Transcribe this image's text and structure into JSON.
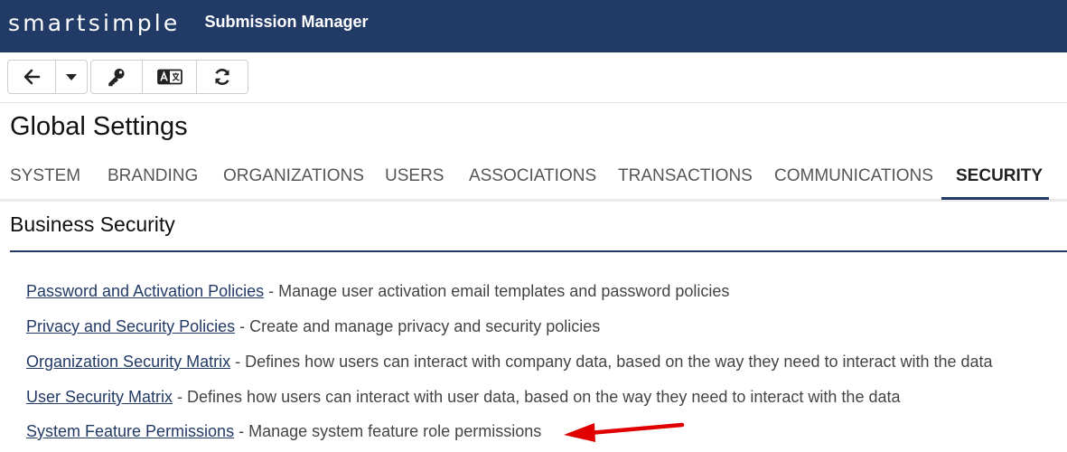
{
  "header": {
    "logo_text": "smartsimple",
    "app_title": "Submission Manager"
  },
  "toolbar": {
    "buttons": [
      {
        "icon": "arrow-left-icon",
        "label": "Back"
      },
      {
        "icon": "caret-down-icon",
        "label": "History"
      },
      {
        "icon": "key-icon",
        "label": "Key"
      },
      {
        "icon": "translate-icon",
        "label": "Translate"
      },
      {
        "icon": "refresh-icon",
        "label": "Refresh"
      }
    ]
  },
  "page": {
    "title": "Global Settings"
  },
  "tabs": [
    {
      "label": "SYSTEM",
      "active": false
    },
    {
      "label": "BRANDING",
      "active": false
    },
    {
      "label": "ORGANIZATIONS",
      "active": false
    },
    {
      "label": "USERS",
      "active": false
    },
    {
      "label": "ASSOCIATIONS",
      "active": false
    },
    {
      "label": "TRANSACTIONS",
      "active": false
    },
    {
      "label": "COMMUNICATIONS",
      "active": false
    },
    {
      "label": "SECURITY",
      "active": true
    }
  ],
  "section": {
    "title": "Business Security",
    "items": [
      {
        "link": "Password and Activation Policies",
        "desc": " - Manage user activation email templates and password policies"
      },
      {
        "link": "Privacy and Security Policies",
        "desc": " - Create and manage privacy and security policies"
      },
      {
        "link": "Organization Security Matrix",
        "desc": " - Defines how users can interact with company data, based on the way they need to interact with the data"
      },
      {
        "link": "User Security Matrix",
        "desc": " - Defines how users can interact with user data, based on the way they need to interact with the data"
      },
      {
        "link": "System Feature Permissions",
        "desc": " - Manage system feature role permissions"
      }
    ]
  },
  "colors": {
    "header_bg": "#223a66",
    "link": "#223a66",
    "annotation_arrow": "#e00000"
  }
}
